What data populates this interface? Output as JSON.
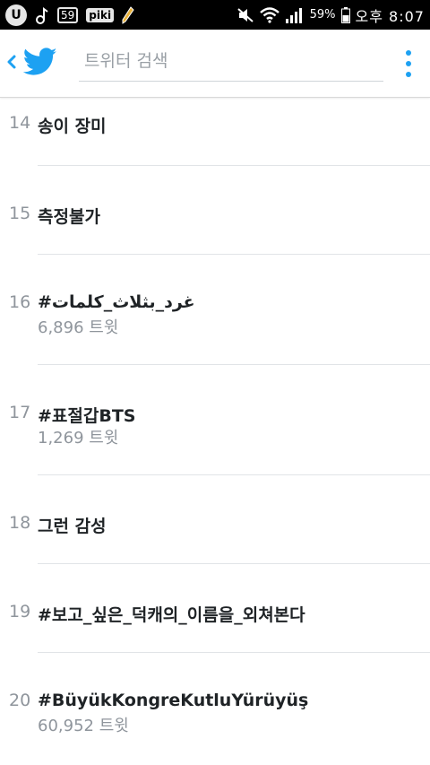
{
  "status_bar": {
    "left_badges": [
      "U",
      "59",
      "piki"
    ],
    "battery": "59%",
    "time": "오후 8:07"
  },
  "header": {
    "search_placeholder": "트위터 검색"
  },
  "trends": [
    {
      "rank": "14",
      "name": "송이 장미",
      "count": ""
    },
    {
      "rank": "15",
      "name": "측정불가",
      "count": ""
    },
    {
      "rank": "16",
      "name": "#غرد_بثلاث_كلمات",
      "count": "6,896 트윗"
    },
    {
      "rank": "17",
      "name": "#표절갑BTS",
      "count": "1,269 트윗"
    },
    {
      "rank": "18",
      "name": "그런 감성",
      "count": ""
    },
    {
      "rank": "19",
      "name": "#보고_싶은_덕캐의_이름을_외쳐본다",
      "count": ""
    },
    {
      "rank": "20",
      "name": "#BüyükKongreKutluYürüyüş",
      "count": "60,952 트윗"
    }
  ],
  "colors": {
    "twitter_blue": "#1da1f2",
    "rank_gray": "#8f959c",
    "text_dark": "#1f2326"
  }
}
